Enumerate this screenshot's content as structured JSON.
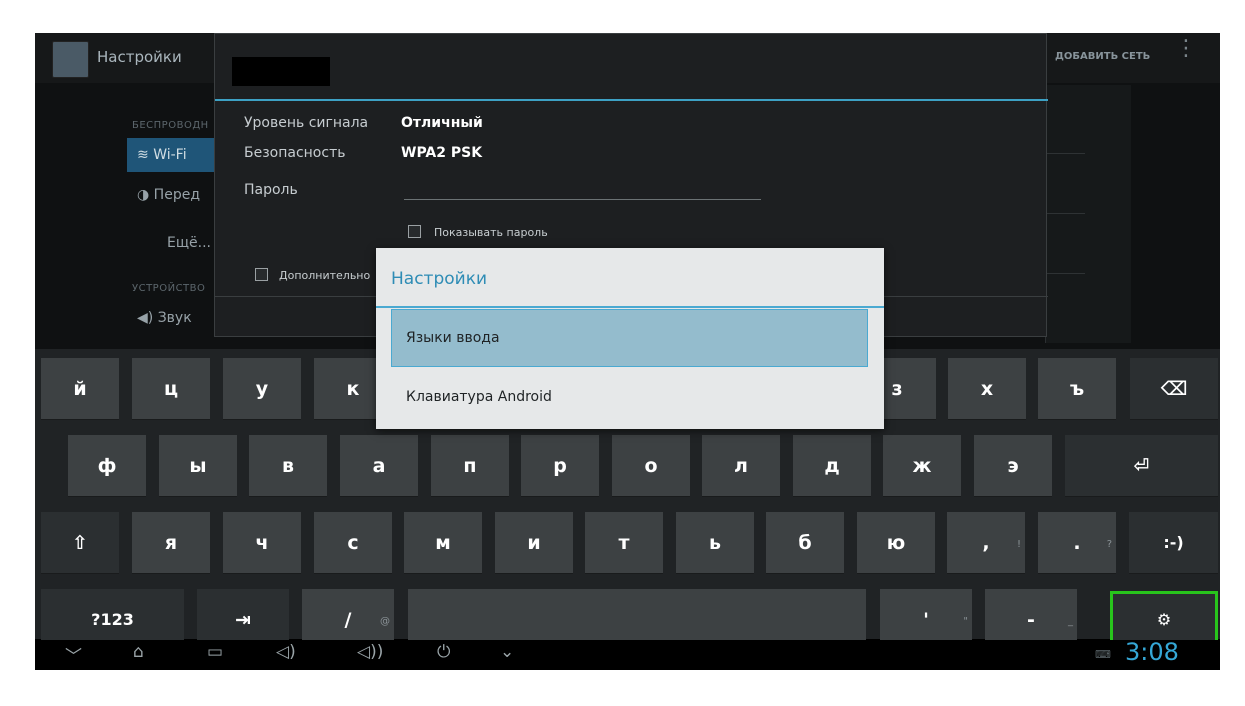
{
  "settings_app": {
    "title": "Настройки",
    "add_network": "ДОБАВИТЬ СЕТЬ",
    "overflow": "⋮",
    "categories": {
      "wireless": "БЕСПРОВОДН",
      "device": "УСТРОЙСТВО"
    },
    "nav": {
      "wifi": "Wi-Fi",
      "data": "Перед",
      "more": "Ещё...",
      "sound": "Звук"
    }
  },
  "wifi_dialog": {
    "signal_label": "Уровень сигнала",
    "signal_value": "Отличный",
    "security_label": "Безопасность",
    "security_value": "WPA2 PSK",
    "password_label": "Пароль",
    "show_password": "Показывать пароль",
    "advanced": "Дополнительно"
  },
  "popup": {
    "title": "Настройки",
    "options": [
      "Языки ввода",
      "Клавиатура Android"
    ],
    "selected": 0
  },
  "keyboard": {
    "row1": [
      "й",
      "ц",
      "у",
      "к",
      "з",
      "х",
      "ъ"
    ],
    "backspace_icon": "⌫",
    "row2": [
      "ф",
      "ы",
      "в",
      "а",
      "п",
      "р",
      "о",
      "л",
      "д",
      "ж",
      "э"
    ],
    "enter_icon": "⏎",
    "row3": [
      "я",
      "ч",
      "с",
      "м",
      "и",
      "т",
      "ь",
      "б",
      "ю"
    ],
    "shift_icon": "⇧",
    "comma": ",",
    "comma_hint": "!",
    "period": ".",
    "period_hint": "?",
    "smiley": ":-)",
    "symbols": "?123",
    "tab_icon": "⇥",
    "slash": "/",
    "slash_hint": "@",
    "apostrophe": "'",
    "apostrophe_hint": "\"",
    "dash": "-",
    "dash_hint": "_",
    "settings_icon": "⚙"
  },
  "navbar": {
    "time": "3:08",
    "icons": [
      "hide-keyboard-icon",
      "home-icon",
      "recent-apps-icon",
      "volume-down-icon",
      "volume-up-icon",
      "power-icon",
      "expand-icon"
    ]
  },
  "colors": {
    "accent": "#35a7d6",
    "highlight": "#28c51c"
  }
}
